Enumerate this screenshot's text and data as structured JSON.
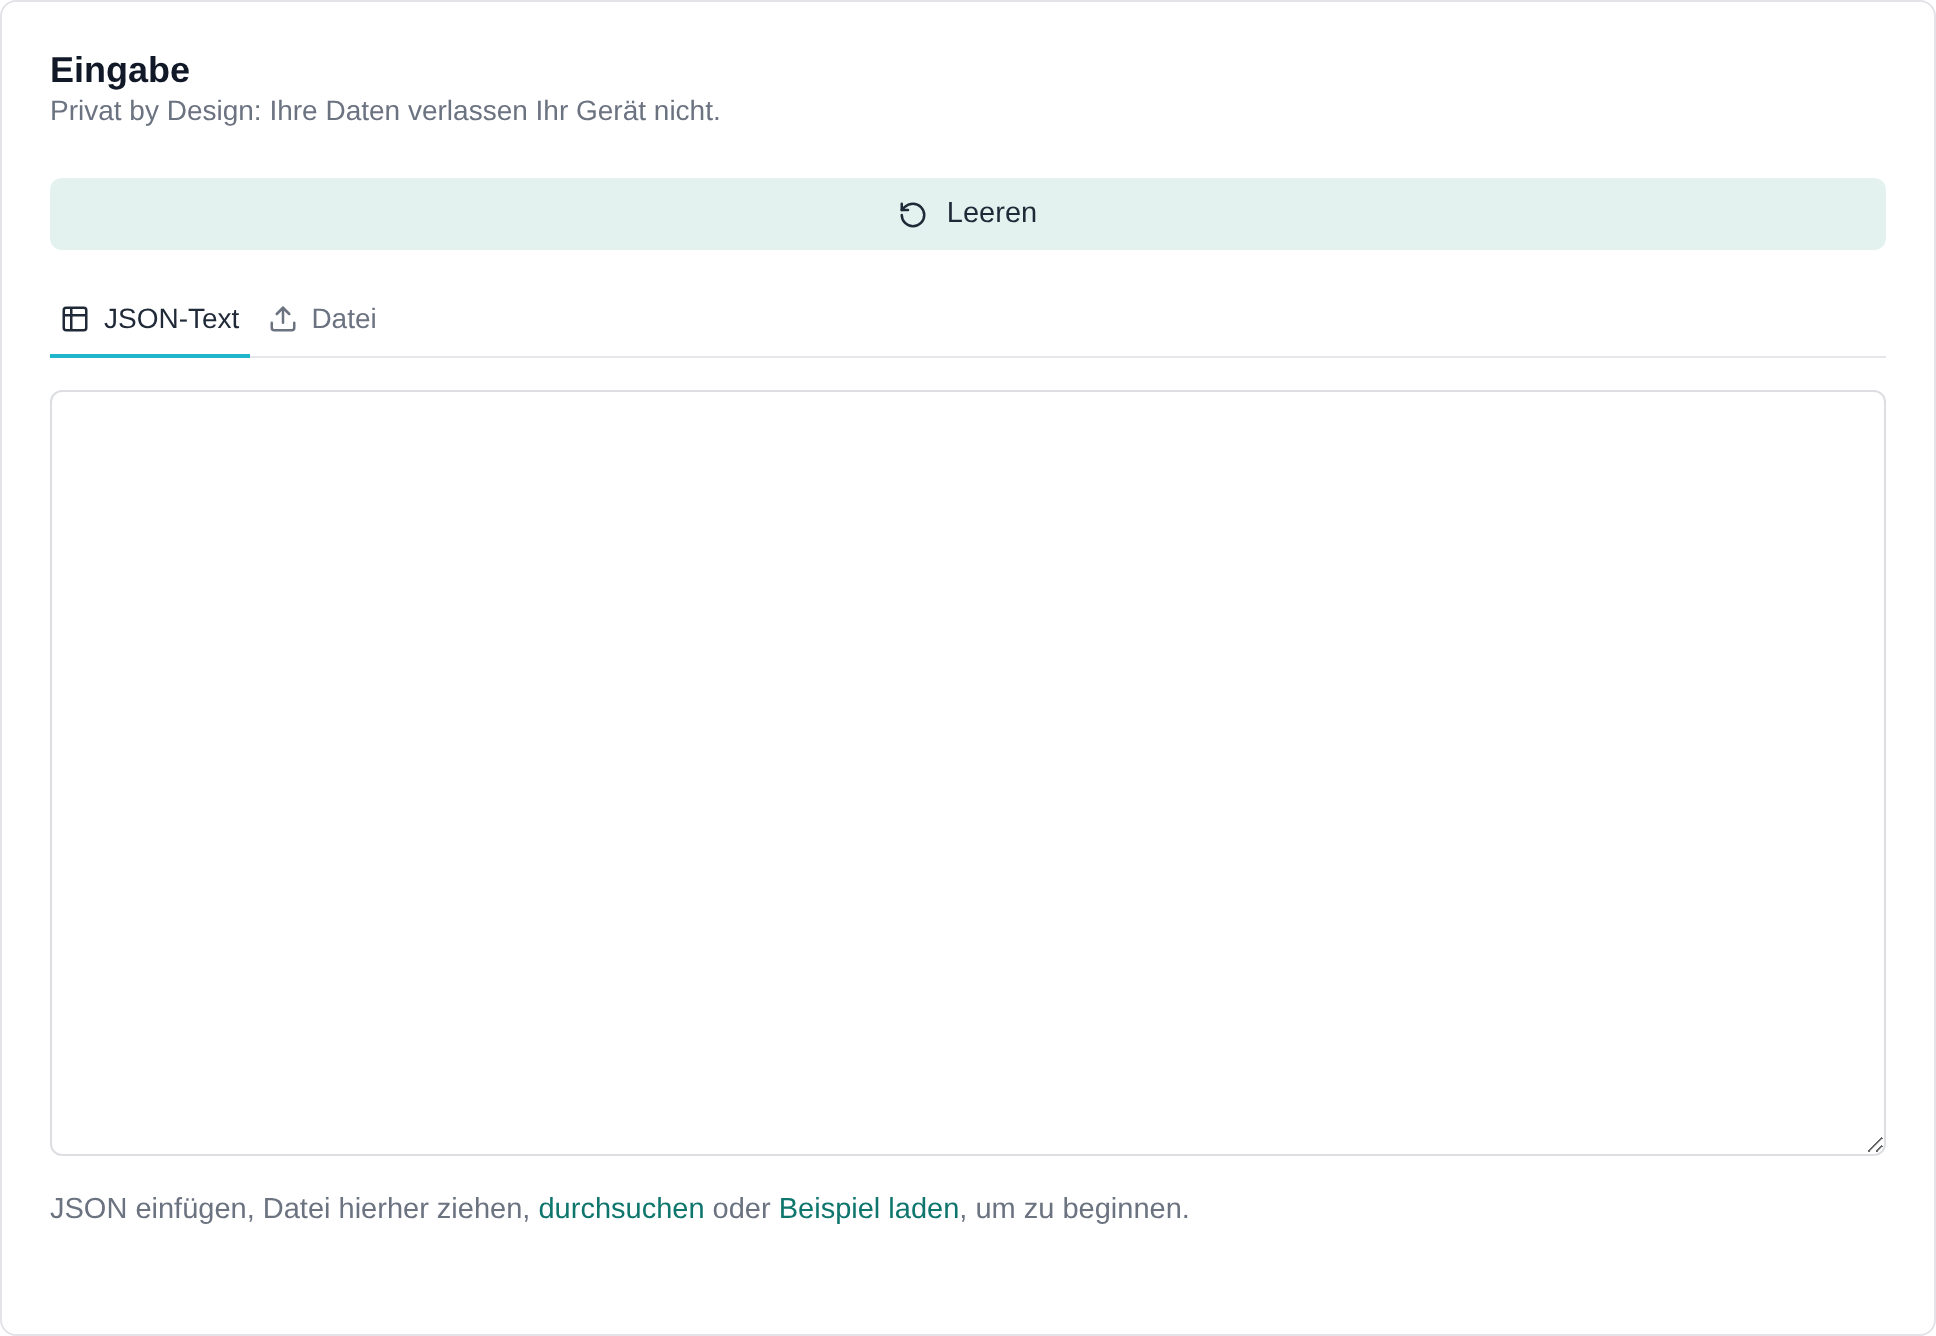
{
  "panel": {
    "title": "Eingabe",
    "subtitle": "Privat by Design: Ihre Daten verlassen Ihr Gerät nicht."
  },
  "clear_button": {
    "label": "Leeren"
  },
  "tabs": [
    {
      "kind": "text",
      "label": "JSON-Text",
      "selected": true
    },
    {
      "kind": "file",
      "label": "Datei",
      "selected": false
    }
  ],
  "hint": [
    {
      "kind": "text",
      "text": "JSON einfügen, Datei hierher ziehen, "
    },
    {
      "kind": "link",
      "text": "durchsuchen"
    },
    {
      "kind": "text",
      "text": " oder "
    },
    {
      "kind": "link",
      "text": "Beispiel laden"
    },
    {
      "kind": "text",
      "text": ", um zu beginnen."
    }
  ]
}
